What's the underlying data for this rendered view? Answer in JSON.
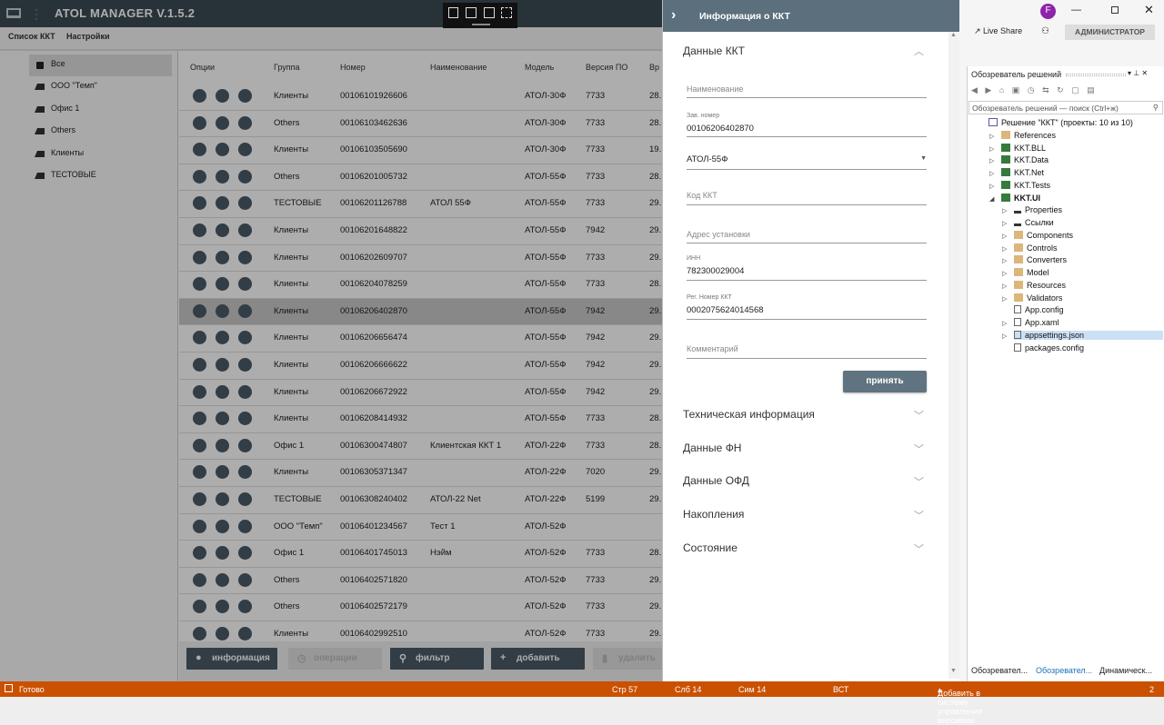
{
  "app": {
    "title": "ATOL MANAGER V.1.5.2",
    "tabs": [
      "Список ККТ",
      "Настройки"
    ]
  },
  "groups": [
    {
      "label": "Все",
      "icon": "lock-icon",
      "selected": true
    },
    {
      "label": "ООО \"Темп\"",
      "icon": "factory-icon"
    },
    {
      "label": "Офис 1",
      "icon": "factory-icon"
    },
    {
      "label": "Others",
      "icon": "factory-icon"
    },
    {
      "label": "Клиенты",
      "icon": "factory-icon"
    },
    {
      "label": "ТЕСТОВЫЕ",
      "icon": "factory-icon"
    }
  ],
  "table": {
    "headers": [
      "Опции",
      "Группа",
      "Номер",
      "Наименование",
      "Модель",
      "Версия ПО",
      "Вр"
    ],
    "rows": [
      [
        "Клиенты",
        "00106101926606",
        "",
        "АТОЛ-30Ф",
        "7733",
        "28."
      ],
      [
        "Others",
        "00106103462636",
        "",
        "АТОЛ-30Ф",
        "7733",
        "28."
      ],
      [
        "Клиенты",
        "00106103505690",
        "",
        "АТОЛ-30Ф",
        "7733",
        "19."
      ],
      [
        "Others",
        "00106201005732",
        "",
        "АТОЛ-55Ф",
        "7733",
        "28."
      ],
      [
        "ТЕСТОВЫЕ",
        "00106201126788",
        "АТОЛ 55Ф",
        "АТОЛ-55Ф",
        "7733",
        "29."
      ],
      [
        "Клиенты",
        "00106201648822",
        "",
        "АТОЛ-55Ф",
        "7942",
        "29."
      ],
      [
        "Клиенты",
        "00106202609707",
        "",
        "АТОЛ-55Ф",
        "7733",
        "29."
      ],
      [
        "Клиенты",
        "00106204078259",
        "",
        "АТОЛ-55Ф",
        "7733",
        "28."
      ],
      [
        "Клиенты",
        "00106206402870",
        "",
        "АТОЛ-55Ф",
        "7942",
        "29."
      ],
      [
        "Клиенты",
        "00106206656474",
        "",
        "АТОЛ-55Ф",
        "7942",
        "29."
      ],
      [
        "Клиенты",
        "00106206666622",
        "",
        "АТОЛ-55Ф",
        "7942",
        "29."
      ],
      [
        "Клиенты",
        "00106206672922",
        "",
        "АТОЛ-55Ф",
        "7942",
        "29."
      ],
      [
        "Клиенты",
        "00106208414932",
        "",
        "АТОЛ-55Ф",
        "7733",
        "28."
      ],
      [
        "Офис 1",
        "00106300474807",
        "Клиентская ККТ 1",
        "АТОЛ-22Ф",
        "7733",
        "28."
      ],
      [
        "Клиенты",
        "00106305371347",
        "",
        "АТОЛ-22Ф",
        "7020",
        "29."
      ],
      [
        "ТЕСТОВЫЕ",
        "00106308240402",
        "АТОЛ-22 Net",
        "АТОЛ-22Ф",
        "5199",
        "29."
      ],
      [
        "ООО \"Темп\"",
        "00106401234567",
        "Тест 1",
        "АТОЛ-52Ф",
        "",
        ""
      ],
      [
        "Офис 1",
        "00106401745013",
        "Нэйм",
        "АТОЛ-52Ф",
        "7733",
        "28."
      ],
      [
        "Others",
        "00106402571820",
        "",
        "АТОЛ-52Ф",
        "7733",
        "29."
      ],
      [
        "Others",
        "00106402572179",
        "",
        "АТОЛ-52Ф",
        "7733",
        "29."
      ],
      [
        "Клиенты",
        "00106402992510",
        "",
        "АТОЛ-52Ф",
        "7733",
        "29."
      ]
    ],
    "selected_row": 8
  },
  "bottom": {
    "info": "информация",
    "ops": "операции",
    "filter": "фильтр",
    "add": "добавить",
    "delete": "удалить"
  },
  "panel": {
    "title": "Информация о ККТ",
    "section_main": "Данные ККТ",
    "fields": {
      "name_placeholder": "Наименование",
      "serial_label": "Зав. номер",
      "serial_value": "00106206402870",
      "model_value": "АТОЛ-55Ф",
      "code_placeholder": "Код ККТ",
      "address_placeholder": "Адрес установки",
      "inn_label": "ИНН",
      "inn_value": "782300029004",
      "reg_label": "Рег. Номер ККТ",
      "reg_value": "0002075624014568",
      "comment_placeholder": "Комментарий"
    },
    "accept": "принять",
    "sections": [
      "Техническая информация",
      "Данные ФН",
      "Данные ОФД",
      "Накопления",
      "Состояние"
    ]
  },
  "vs": {
    "live_share": "Live Share",
    "admin": "АДМИНИСТРАТОР",
    "avatar": "F",
    "explorer_title": "Обозреватель решений",
    "search_placeholder": "Обозреватель решений — поиск (Ctrl+ж)",
    "tree": [
      {
        "label": "Решение \"ККТ\" (проекты: 10 из 10)",
        "lvl": 0,
        "ic": "sln"
      },
      {
        "label": "References",
        "lvl": 1,
        "ic": "fold",
        "tri": "▷"
      },
      {
        "label": "KKT.BLL",
        "lvl": 1,
        "ic": "cs",
        "tri": "▷"
      },
      {
        "label": "KKT.Data",
        "lvl": 1,
        "ic": "cs",
        "tri": "▷"
      },
      {
        "label": "KKT.Net",
        "lvl": 1,
        "ic": "cs",
        "tri": "▷"
      },
      {
        "label": "KKT.Tests",
        "lvl": 1,
        "ic": "cs",
        "tri": "▷"
      },
      {
        "label": "KKT.UI",
        "lvl": 1,
        "ic": "cs",
        "tri": "◢",
        "bold": true
      },
      {
        "label": "Properties",
        "lvl": 2,
        "ic": "wrench",
        "tri": "▷"
      },
      {
        "label": "Ссылки",
        "lvl": 2,
        "ic": "ref",
        "tri": "▷"
      },
      {
        "label": "Components",
        "lvl": 2,
        "ic": "fold",
        "tri": "▷"
      },
      {
        "label": "Controls",
        "lvl": 2,
        "ic": "fold",
        "tri": "▷"
      },
      {
        "label": "Converters",
        "lvl": 2,
        "ic": "fold",
        "tri": "▷"
      },
      {
        "label": "Model",
        "lvl": 2,
        "ic": "fold",
        "tri": "▷"
      },
      {
        "label": "Resources",
        "lvl": 2,
        "ic": "fold",
        "tri": "▷"
      },
      {
        "label": "Validators",
        "lvl": 2,
        "ic": "fold",
        "tri": "▷"
      },
      {
        "label": "App.config",
        "lvl": 2,
        "ic": "file"
      },
      {
        "label": "App.xaml",
        "lvl": 2,
        "ic": "file",
        "tri": "▷"
      },
      {
        "label": "appsettings.json",
        "lvl": 2,
        "ic": "file",
        "tri": "▷",
        "selected": true
      },
      {
        "label": "packages.config",
        "lvl": 2,
        "ic": "file"
      }
    ],
    "bottom_tabs": [
      "Обозревател...",
      "Обозревател...",
      "Динамическ..."
    ]
  },
  "status": {
    "ready": "Готово",
    "line": "Стр 57",
    "col": "Слб 14",
    "ch": "Сим 14",
    "mode": "ВСТ",
    "vcs": "Добавить в систему управления версиями",
    "count": "2"
  }
}
